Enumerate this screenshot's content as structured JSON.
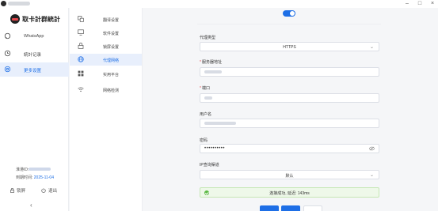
{
  "window": {
    "minimize": "–",
    "maximize": "□",
    "close": "×"
  },
  "sidebar": {
    "app_title": "取卡計群統計",
    "items": [
      {
        "label": "WhatsApp",
        "icon": "whatsapp-icon"
      },
      {
        "label": "統計记录",
        "icon": "clock-icon"
      },
      {
        "label": "更多设置",
        "icon": "gear-icon",
        "active": true
      }
    ],
    "account_label": "淮港ID:",
    "expire_label": "到期时间:",
    "expire_value": "2025-11-04",
    "lock_label": "锁屏",
    "logout_label": "退出",
    "collapse": "‹"
  },
  "settings_nav": {
    "items": [
      {
        "label": "翻译设置",
        "icon": "translate-icon"
      },
      {
        "label": "软件设置",
        "icon": "monitor-icon"
      },
      {
        "label": "锁屏设置",
        "icon": "lock-icon"
      },
      {
        "label": "代理网络",
        "icon": "globe-icon",
        "active": true
      },
      {
        "label": "实用平台",
        "icon": "grid-icon"
      },
      {
        "label": "网络检测",
        "icon": "wifi-icon"
      }
    ]
  },
  "proxy": {
    "enabled": true,
    "type_label": "代理类型",
    "type_value": "HTTPS",
    "server_label": "服务器地址",
    "port_label": "端口",
    "username_label": "用户名",
    "password_label": "密码",
    "password_mask": "••••••••••",
    "ip_label": "IP查询渠道",
    "ip_value": "默认",
    "status_text": "连接成功, 延迟: 143ms"
  },
  "colors": {
    "accent": "#1e6fe6",
    "success": "#5bb943",
    "danger": "#e5484d"
  }
}
